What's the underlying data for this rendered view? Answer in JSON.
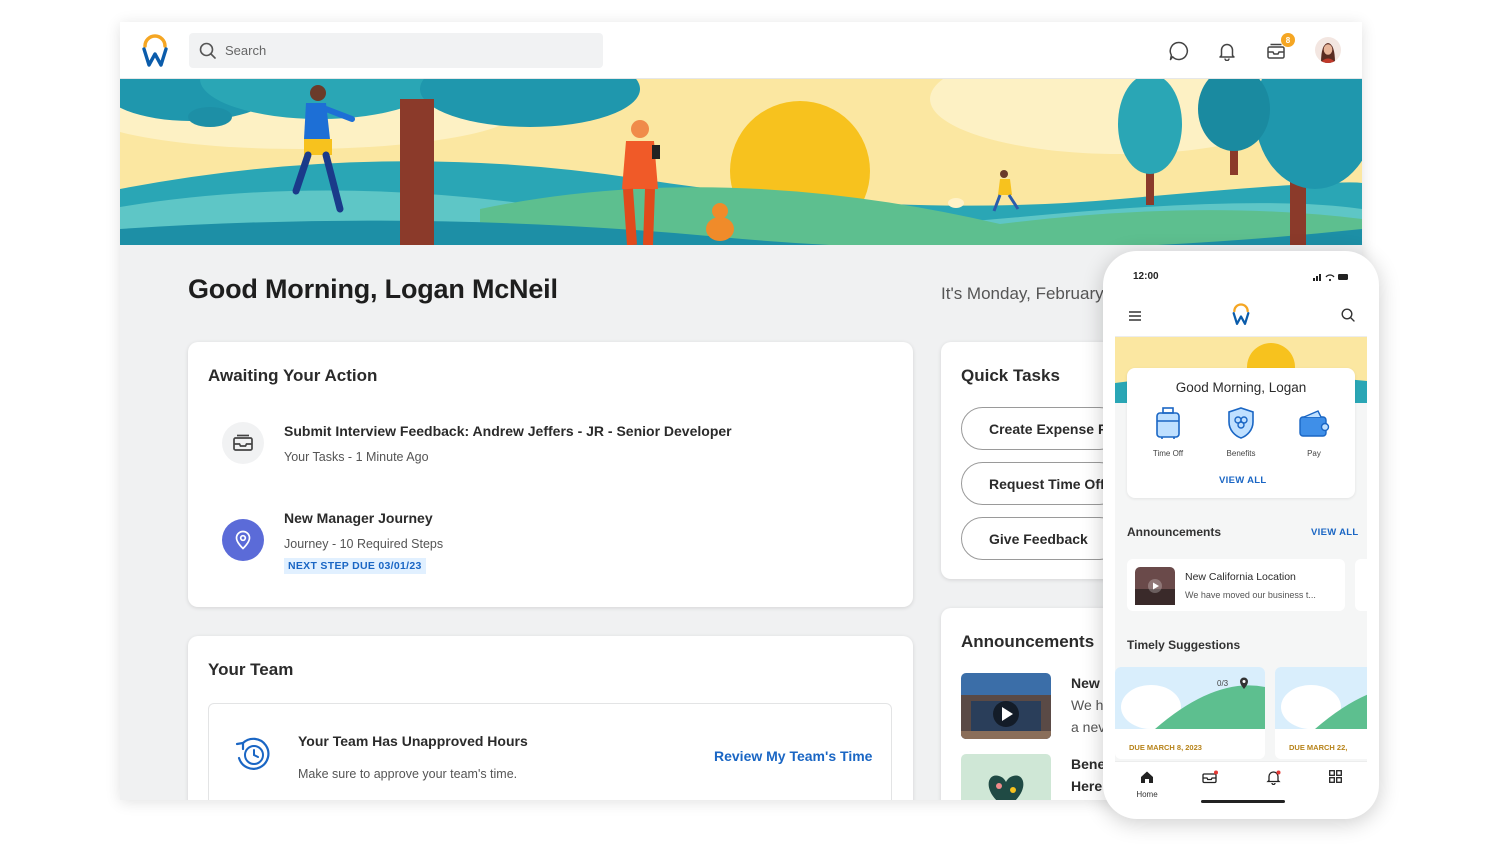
{
  "header": {
    "search_placeholder": "Search",
    "inbox_badge": "8"
  },
  "greeting": {
    "title": "Good Morning, Logan McNeil",
    "date": "It's Monday, February"
  },
  "awaiting": {
    "title": "Awaiting Your Action",
    "items": [
      {
        "title": "Submit Interview Feedback: Andrew Jeffers - JR - Senior Developer",
        "subtitle": "Your Tasks - 1 Minute Ago",
        "icon": "inbox-icon"
      },
      {
        "title": "New Manager Journey",
        "subtitle": "Journey - 10 Required Steps",
        "tag": "NEXT STEP DUE 03/01/23",
        "icon": "location-pin-icon"
      }
    ]
  },
  "team": {
    "title": "Your Team",
    "item_title": "Your Team Has Unapproved Hours",
    "item_subtitle": "Make sure to approve your team's time.",
    "link": "Review My Team's Time"
  },
  "quick_tasks": {
    "title": "Quick Tasks",
    "buttons": [
      "Create Expense Re",
      "Request Time Off",
      "Give Feedback"
    ]
  },
  "announcements": {
    "title": "Announcements",
    "items": [
      {
        "line1": "New",
        "line2": "We h",
        "line3": "a nev"
      },
      {
        "line1": "Bene",
        "line2": "Here"
      }
    ]
  },
  "phone": {
    "time": "12:00",
    "greeting": "Good Morning, Logan",
    "apps": [
      "Time Off",
      "Benefits",
      "Pay"
    ],
    "view_all": "VIEW ALL",
    "announcements_title": "Announcements",
    "announcements_view_all": "VIEW ALL",
    "announcement_title": "New California Location",
    "announcement_sub": "We have moved our business t...",
    "suggestions_title": "Timely Suggestions",
    "suggestions": [
      {
        "due": "DUE MARCH 8, 2023",
        "count": "0/3"
      },
      {
        "due": "DUE MARCH 22,"
      }
    ],
    "nav": [
      {
        "label": "Home",
        "icon": "home-icon"
      },
      {
        "label": "",
        "icon": "inbox-icon"
      },
      {
        "label": "",
        "icon": "bell-icon"
      },
      {
        "label": "",
        "icon": "apps-icon"
      }
    ]
  },
  "colors": {
    "accent_blue": "#1a66c4",
    "brand_orange": "#f5a623",
    "journey_purple": "#5b6bd8"
  }
}
